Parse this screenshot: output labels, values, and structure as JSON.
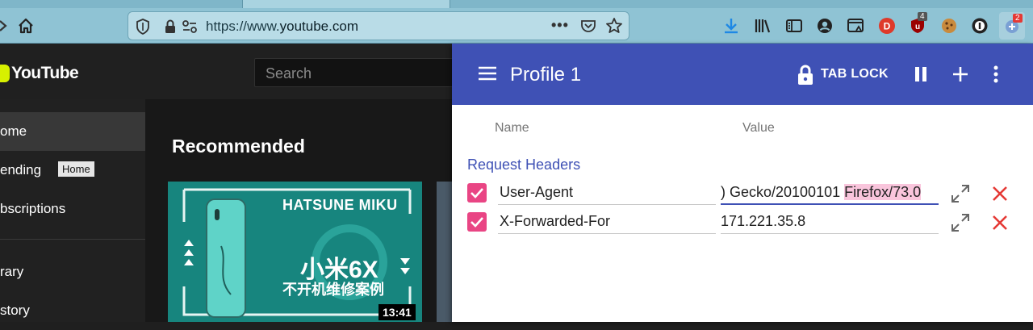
{
  "browser": {
    "url_prefix": "https://www.",
    "url_host": "youtube.com",
    "url_suffix": "",
    "badge_ublock": "4",
    "badge_extension": "2"
  },
  "youtube": {
    "logo_text": "YouTube",
    "search_placeholder": "Search",
    "sidebar": [
      {
        "label": "ome",
        "active": true
      },
      {
        "label": "ending",
        "active": false
      },
      {
        "label": "bscriptions",
        "active": false
      },
      {
        "label": "rary",
        "active": false
      },
      {
        "label": "story",
        "active": false
      }
    ],
    "tooltip": "Home",
    "section_title": "Recommended",
    "video": {
      "title_en": "HATSUNE MIKU",
      "title_cn": "小米6X",
      "subtitle_cn": "不开机维修案例",
      "duration": "13:41"
    }
  },
  "popup": {
    "title": "Profile 1",
    "tab_lock_label": "TAB LOCK",
    "columns": {
      "name": "Name",
      "value": "Value"
    },
    "section_title": "Request Headers",
    "rows": [
      {
        "name": "User-Agent",
        "value_plain": ") Gecko/20100101 ",
        "value_highlight": "Firefox/73.0",
        "enabled": true
      },
      {
        "name": "X-Forwarded-For",
        "value_plain": "171.221.35.8",
        "value_highlight": "",
        "enabled": true
      }
    ],
    "colors": {
      "header": "#3f51b5",
      "checkbox": "#e94584",
      "delete": "#e53935"
    }
  }
}
